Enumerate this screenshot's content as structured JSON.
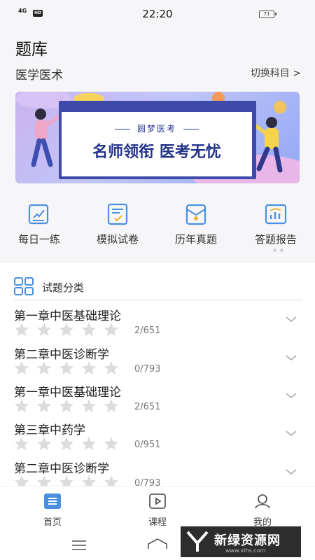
{
  "status": {
    "signal": "4G",
    "hd": "HD",
    "time": "22:20",
    "battery": "71"
  },
  "header": {
    "title": "题库",
    "subject": "医学医术",
    "switch_label": "切换科目 >"
  },
  "banner": {
    "tagline": "圆梦医考",
    "slogan": "名师领衔 医考无忧"
  },
  "nav": [
    {
      "label": "每日一练",
      "icon": "daily-practice-icon"
    },
    {
      "label": "模拟试卷",
      "icon": "mock-exam-icon"
    },
    {
      "label": "历年真题",
      "icon": "past-exam-icon"
    },
    {
      "label": "答题报告",
      "icon": "report-chart-icon"
    }
  ],
  "categories": {
    "title": "试题分类",
    "items": [
      {
        "name": "第一章中医基础理论",
        "count": "2/651",
        "stars": 0
      },
      {
        "name": "第二章中医诊断学",
        "count": "0/793",
        "stars": 0
      },
      {
        "name": "第一章中医基础理论",
        "count": "2/651",
        "stars": 0
      },
      {
        "name": "第三章中药学",
        "count": "0/951",
        "stars": 0
      },
      {
        "name": "第二章中医诊断学",
        "count": "0/793",
        "stars": 0
      }
    ]
  },
  "tabs": [
    {
      "label": "首页",
      "icon": "home-list-icon",
      "active": true
    },
    {
      "label": "课程",
      "icon": "play-course-icon",
      "active": false
    },
    {
      "label": "我的",
      "icon": "user-icon",
      "active": false
    }
  ],
  "watermark": {
    "text": "新绿资源网",
    "sub": "www.xlhs.com"
  },
  "colors": {
    "accent": "#4a8fe0",
    "star": "#dcdcdc",
    "icon_blue": "#4a8fe0"
  }
}
